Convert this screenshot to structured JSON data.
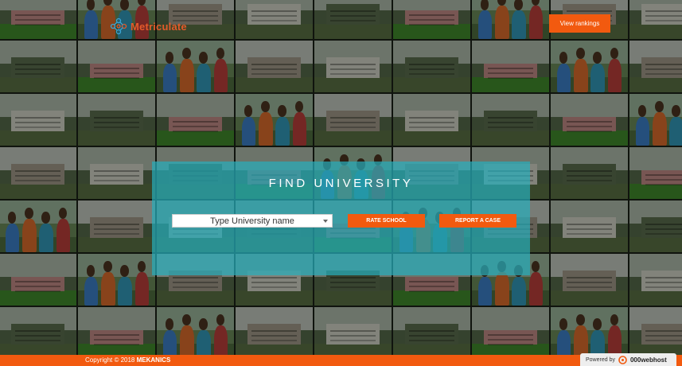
{
  "header": {
    "logo_text": "Metriculate",
    "view_rankings_label": "View rankings"
  },
  "panel": {
    "title": "FIND UNIVERSITY",
    "select_placeholder": "Type University name",
    "rate_school_label": "RATE SCHOOL",
    "report_case_label": "REPORT A CASE"
  },
  "footer": {
    "copyright_prefix": "Copyright © 2018",
    "brand": "MEKANICS",
    "powered_by": "Powered by",
    "host_name": "000webhost"
  },
  "colors": {
    "accent": "#f25a0f",
    "panel": "#26afbe"
  },
  "icons": {
    "logo": "molecule-logo-icon",
    "select": "chevron-down-icon",
    "host": "000webhost-logo-icon"
  }
}
